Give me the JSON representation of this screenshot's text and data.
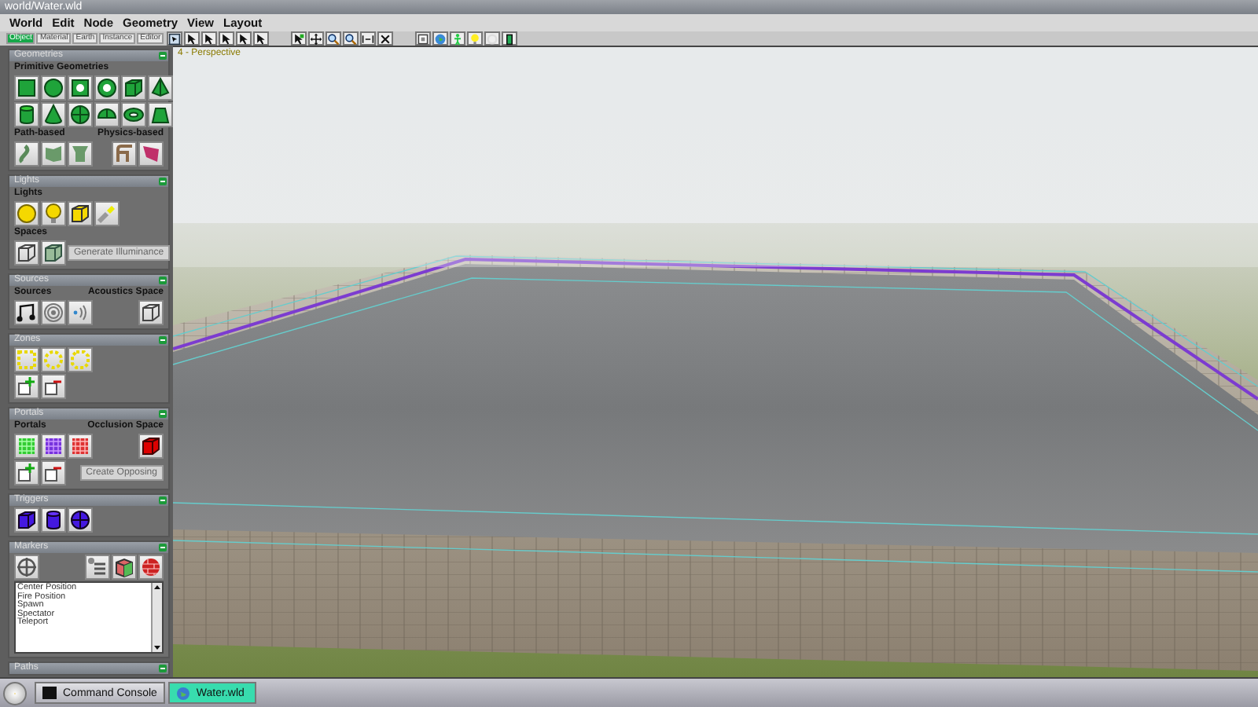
{
  "window": {
    "title": "world/Water.wld"
  },
  "menu": [
    {
      "label": "World"
    },
    {
      "label": "Edit"
    },
    {
      "label": "Node"
    },
    {
      "label": "Geometry"
    },
    {
      "label": "View"
    },
    {
      "label": "Layout"
    }
  ],
  "panel_tabs": [
    {
      "label": "Object",
      "selected": true
    },
    {
      "label": "Material",
      "selected": false
    },
    {
      "label": "Earth",
      "selected": false
    },
    {
      "label": "Instance",
      "selected": false
    },
    {
      "label": "Editor",
      "selected": false
    }
  ],
  "sections": [
    {
      "title": "Geometries",
      "expanded": true,
      "rows": [
        {
          "kind": "heading",
          "left": "Primitive Geometries"
        },
        {
          "kind": "icons"
        },
        {
          "kind": "icons"
        },
        {
          "kind": "heading",
          "left": "Path-based",
          "right": "Physics-based"
        },
        {
          "kind": "icons"
        }
      ]
    },
    {
      "title": "Lights",
      "expanded": true,
      "rows": [
        {
          "kind": "heading",
          "left": "Lights"
        },
        {
          "kind": "icons"
        },
        {
          "kind": "heading",
          "left": "Spaces"
        },
        {
          "kind": "icons",
          "button": {
            "label": "Generate Illuminance",
            "disabled": true
          }
        }
      ]
    },
    {
      "title": "Sources",
      "expanded": true,
      "rows": [
        {
          "kind": "heading",
          "left": "Sources",
          "right": "Acoustics Space"
        },
        {
          "kind": "icons"
        }
      ]
    },
    {
      "title": "Zones",
      "expanded": true,
      "rows": [
        {
          "kind": "icons"
        },
        {
          "kind": "icons"
        }
      ]
    },
    {
      "title": "Portals",
      "expanded": true,
      "rows": [
        {
          "kind": "heading",
          "left": "Portals",
          "right": "Occlusion Space"
        },
        {
          "kind": "icons"
        },
        {
          "kind": "icons",
          "button": {
            "label": "Create Opposing",
            "disabled": true
          }
        }
      ]
    },
    {
      "title": "Triggers",
      "expanded": true,
      "rows": [
        {
          "kind": "icons"
        }
      ]
    },
    {
      "title": "Markers",
      "expanded": true,
      "rows": [
        {
          "kind": "icons"
        },
        {
          "kind": "list",
          "items": [
            {
              "label": "Center Position",
              "selected": false
            },
            {
              "label": "Fire Position",
              "selected": false
            },
            {
              "label": "Spawn",
              "selected": false
            },
            {
              "label": "Spectator",
              "selected": false
            },
            {
              "label": "Teleport",
              "selected": false
            }
          ]
        }
      ]
    },
    {
      "title": "Paths",
      "expanded": true
    }
  ],
  "viewport": {
    "label": "4 - Perspective"
  },
  "taskbar": [
    {
      "label": "Command Console",
      "selected": false
    },
    {
      "label": "Water.wld",
      "selected": true
    }
  ]
}
